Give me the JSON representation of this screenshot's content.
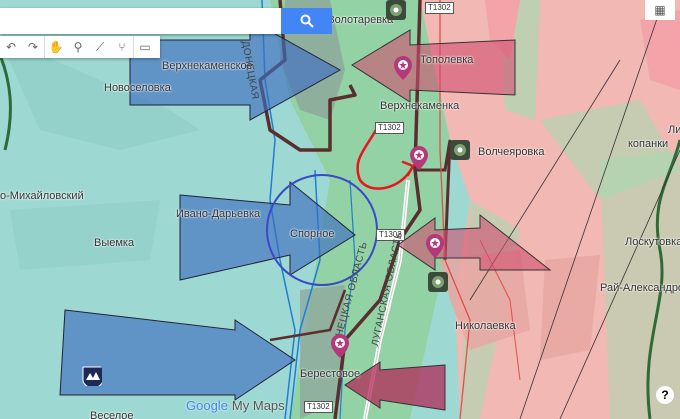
{
  "map": {
    "places": [
      {
        "id": "verkhnekamenskoe",
        "label": "Верхнекаменское"
      },
      {
        "id": "novoselovka",
        "label": "Новоселовка"
      },
      {
        "id": "mikhailovsky",
        "label": "о-Михайловский"
      },
      {
        "id": "ivano_darievka",
        "label": "Ивано-Дарьевка"
      },
      {
        "id": "vyemka",
        "label": "Выемка"
      },
      {
        "id": "spornoe",
        "label": "Спорное"
      },
      {
        "id": "zolotarevka",
        "label": "Золотаревка"
      },
      {
        "id": "verkhnekamenka",
        "label": "Верхнекаменка"
      },
      {
        "id": "topolevka",
        "label": "Тополевка"
      },
      {
        "id": "volcheyarovka",
        "label": "Волчеяровка"
      },
      {
        "id": "lis",
        "label": "Лис"
      },
      {
        "id": "kopanki",
        "label": "копанки"
      },
      {
        "id": "loskutovka",
        "label": "Лоскутовка"
      },
      {
        "id": "rai_aleksandrovka",
        "label": "Рай-Александровк"
      },
      {
        "id": "nikolaevka",
        "label": "Николаевка"
      },
      {
        "id": "berestovoe",
        "label": "Берестовое"
      },
      {
        "id": "veseloe",
        "label": "Веселое"
      }
    ],
    "roads": [
      {
        "id": "t1302_top",
        "label": "T1302"
      },
      {
        "id": "t1302_mid",
        "label": "T1302"
      },
      {
        "id": "t1302_spornoe",
        "label": "T1302"
      },
      {
        "id": "t1302_bottom",
        "label": "T1302"
      }
    ],
    "oblasts": [
      {
        "id": "donetsk_top",
        "label": "ДОНЕЦКАЯ"
      },
      {
        "id": "donetsk_mid",
        "label": "ДОНЕЦКАЯ ОБЛАСТЬ"
      },
      {
        "id": "lugansk",
        "label": "ЛУГАНСКАЯ ОБЛАСТЬ"
      }
    ],
    "colors": {
      "ukraine_area": "#9ed8d2",
      "russia_area": "#f1b8b4",
      "contested_green": "#93d2a5",
      "blue_arrow": "#3f6fc0",
      "red_arrow": "#d04e70",
      "front_line": "#5a2e2e",
      "annotation_red": "#e8161e",
      "circle": "#3949c8"
    }
  },
  "ui": {
    "search": {
      "placeholder": "",
      "value": "",
      "icon": "search-icon"
    },
    "toolbar": {
      "items": [
        "undo-icon",
        "redo-icon",
        "hand-icon",
        "marker-icon",
        "line-icon",
        "route-icon",
        "ruler-icon"
      ]
    },
    "help_label": "?",
    "logo_google": "Google",
    "logo_mymaps": "My Maps",
    "topright_icon": "grid-icon"
  }
}
